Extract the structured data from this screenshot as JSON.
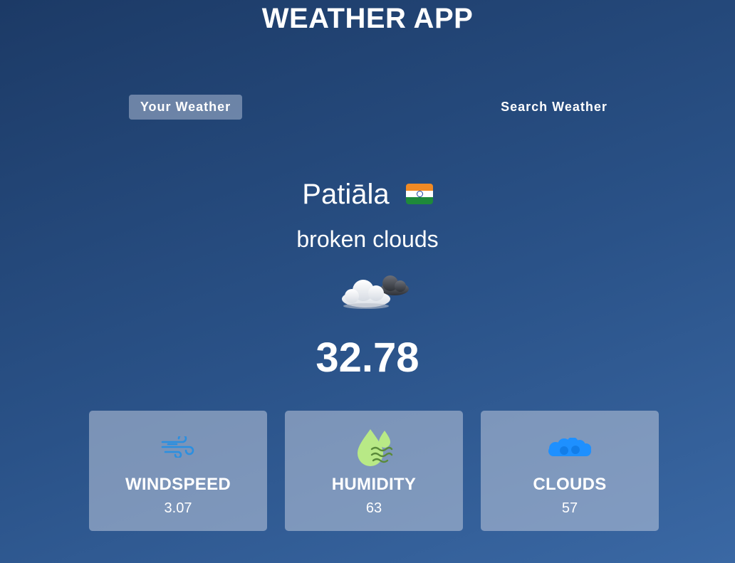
{
  "app": {
    "title": "WEATHER APP"
  },
  "tabs": [
    {
      "label": "Your Weather",
      "active": true
    },
    {
      "label": "Search Weather",
      "active": false
    }
  ],
  "weather": {
    "city": "Patiāla",
    "country_flag_icon": "india-flag-icon",
    "description": "broken clouds",
    "condition_icon": "broken-clouds-icon",
    "temperature": "32.78"
  },
  "stats": {
    "windspeed": {
      "label": "WINDSPEED",
      "value": "3.07",
      "icon": "wind-icon"
    },
    "humidity": {
      "label": "HUMIDITY",
      "value": "63",
      "icon": "humidity-icon"
    },
    "clouds": {
      "label": "CLOUDS",
      "value": "57",
      "icon": "clouds-icon"
    }
  },
  "colors": {
    "background_top": "#1c3a66",
    "background_bottom": "#3a68a4",
    "wind_icon": "#2b8fe0",
    "humidity_icon": "#b8e986",
    "clouds_icon": "#1e90ff"
  }
}
